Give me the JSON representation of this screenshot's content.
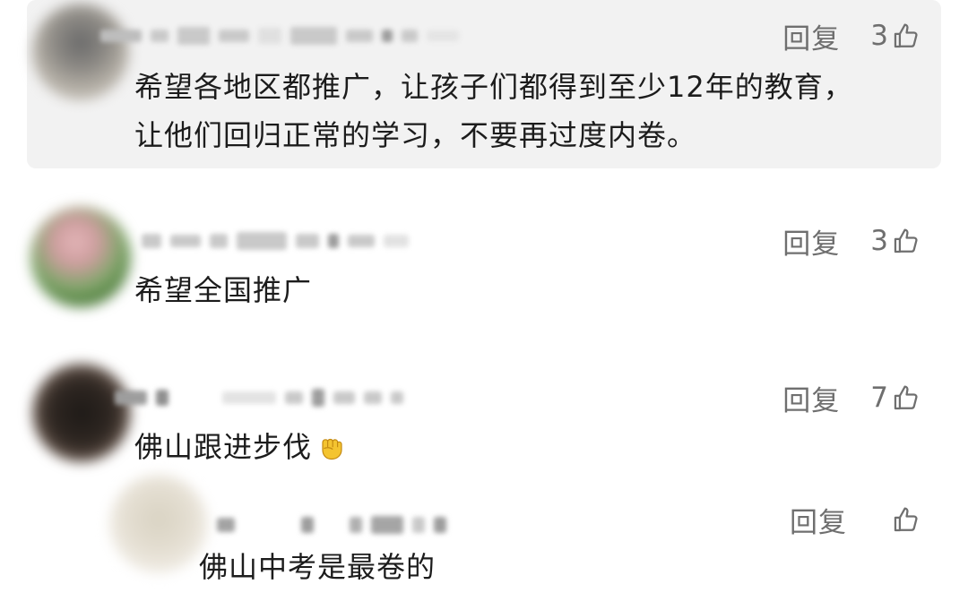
{
  "comments": [
    {
      "text_lines": [
        "希望各地区都推广，让孩子们都得到至少12年的教育，",
        "让他们回归正常的学习，不要再过度内卷。"
      ],
      "reply_label": "回复",
      "likes": "3"
    },
    {
      "text_lines": [
        "希望全国推广"
      ],
      "reply_label": "回复",
      "likes": "3"
    },
    {
      "text_lines": [
        "佛山跟进步伐"
      ],
      "reply_label": "回复",
      "likes": "7"
    },
    {
      "text_lines": [
        "佛山中考是最卷的"
      ],
      "reply_label": "回复",
      "likes": ""
    }
  ],
  "icons": {
    "like": "thumbs-up-icon",
    "emoji": "raised-fist-emoji"
  },
  "colors": {
    "highlight_bg": "#f2f2f2",
    "text": "#1c1c1c",
    "meta": "#6f6f6f"
  }
}
